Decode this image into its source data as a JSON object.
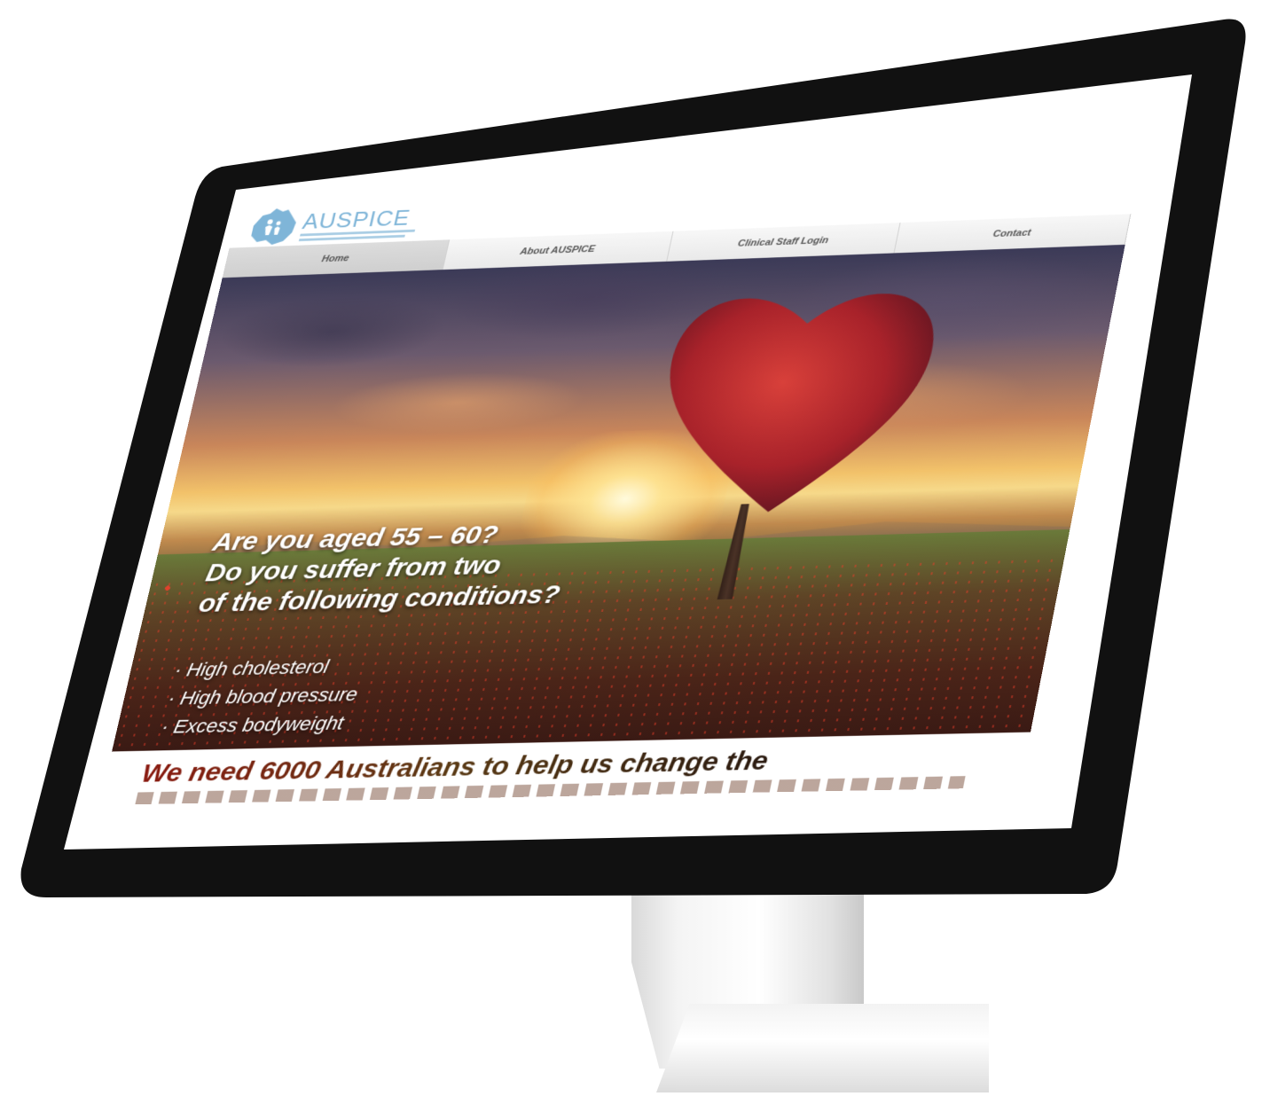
{
  "site": {
    "brand": "AUSPICE",
    "nav": [
      {
        "label": "Home",
        "active": true
      },
      {
        "label": "About AUSPICE",
        "active": false
      },
      {
        "label": "Clinical Staff Login",
        "active": false
      },
      {
        "label": "Contact",
        "active": false
      }
    ],
    "hero": {
      "question_lines": [
        "Are you aged 55 – 60?",
        "Do you suffer from two",
        "of the following conditions?"
      ],
      "conditions": [
        "· High cholesterol",
        "· High blood pressure",
        "· Excess bodyweight"
      ]
    },
    "tagline": "We need 6000 Australians to help us change the"
  },
  "colors": {
    "bezel": "#111111",
    "logo_blue": "#7fb5d8",
    "tagline_red": "#8a1a10",
    "nav_text": "#555555"
  },
  "icons": {
    "logo": "australia-map-family-icon"
  }
}
